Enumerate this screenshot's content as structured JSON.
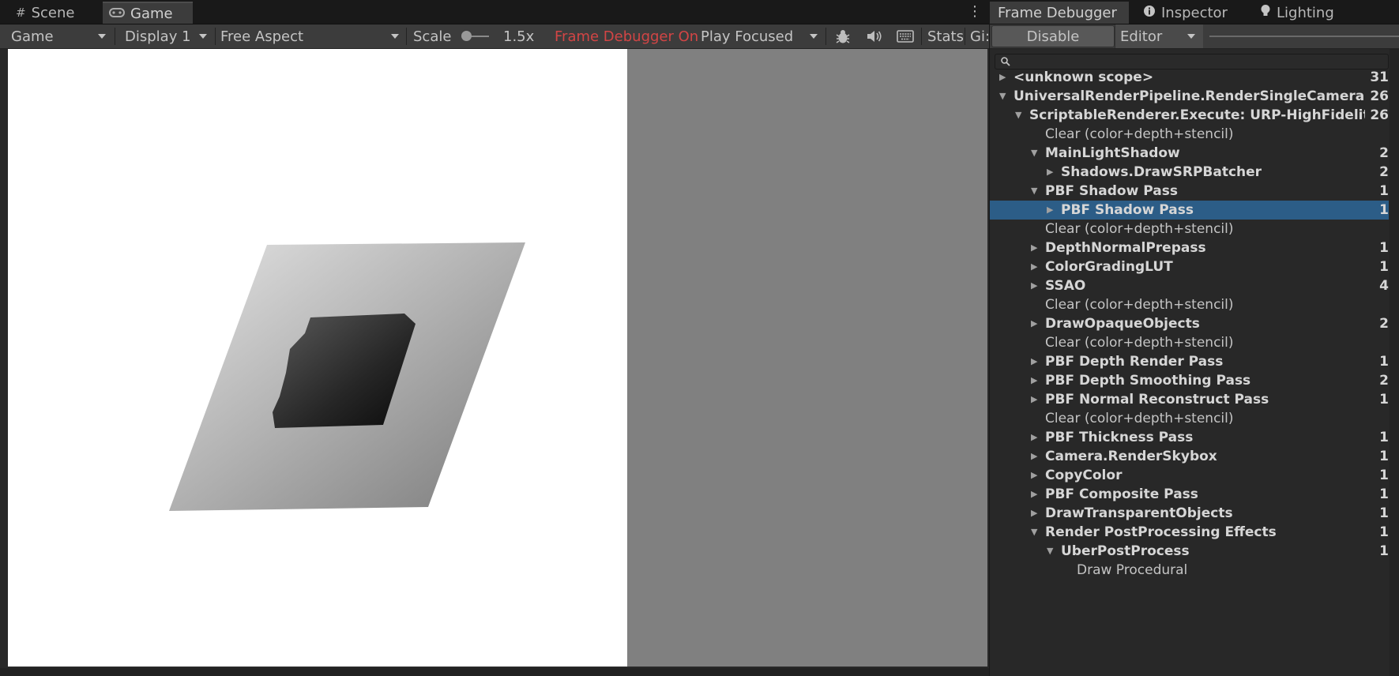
{
  "left": {
    "tabs": [
      {
        "label": "Scene",
        "icon": "grid-hash-icon"
      },
      {
        "label": "Game",
        "icon": "gamepad-icon"
      }
    ],
    "toolbar": {
      "view_select": "Game",
      "display_select": "Display 1",
      "aspect_select": "Free Aspect",
      "scale_label": "Scale",
      "scale_value": "1.5x",
      "frame_debugger_status": "Frame Debugger On",
      "play_mode_select": "Play Focused",
      "stats_label": "Stats",
      "gizmos_label": "Gi:"
    }
  },
  "right": {
    "tabs": [
      {
        "label": "Frame Debugger"
      },
      {
        "label": "Inspector",
        "icon": "info-icon"
      },
      {
        "label": "Lighting",
        "icon": "bulb-icon"
      }
    ],
    "toolbar": {
      "disable_button": "Disable",
      "target_select": "Editor"
    },
    "search": {
      "placeholder": ""
    },
    "tree": [
      {
        "label": "<unknown scope>",
        "count": "31",
        "depth": 0,
        "expander": "collapsed",
        "bold": true
      },
      {
        "label": "UniversalRenderPipeline.RenderSingleCameraInternal",
        "count": "26",
        "depth": 0,
        "expander": "expanded",
        "bold": true
      },
      {
        "label": "ScriptableRenderer.Execute: URP-HighFidelity-Renderer",
        "count": "26",
        "depth": 1,
        "expander": "expanded",
        "bold": true
      },
      {
        "label": "Clear (color+depth+stencil)",
        "count": "",
        "depth": 2,
        "expander": "none",
        "bold": false
      },
      {
        "label": "MainLightShadow",
        "count": "2",
        "depth": 2,
        "expander": "expanded",
        "bold": true
      },
      {
        "label": "Shadows.DrawSRPBatcher",
        "count": "2",
        "depth": 3,
        "expander": "collapsed",
        "bold": true
      },
      {
        "label": "PBF Shadow Pass",
        "count": "1",
        "depth": 2,
        "expander": "expanded",
        "bold": true
      },
      {
        "label": "PBF Shadow Pass",
        "count": "1",
        "depth": 3,
        "expander": "collapsed",
        "bold": true,
        "selected": true
      },
      {
        "label": "Clear (color+depth+stencil)",
        "count": "",
        "depth": 2,
        "expander": "none",
        "bold": false
      },
      {
        "label": "DepthNormalPrepass",
        "count": "1",
        "depth": 2,
        "expander": "collapsed",
        "bold": true
      },
      {
        "label": "ColorGradingLUT",
        "count": "1",
        "depth": 2,
        "expander": "collapsed",
        "bold": true
      },
      {
        "label": "SSAO",
        "count": "4",
        "depth": 2,
        "expander": "collapsed",
        "bold": true
      },
      {
        "label": "Clear (color+depth+stencil)",
        "count": "",
        "depth": 2,
        "expander": "none",
        "bold": false
      },
      {
        "label": "DrawOpaqueObjects",
        "count": "2",
        "depth": 2,
        "expander": "collapsed",
        "bold": true
      },
      {
        "label": "Clear (color+depth+stencil)",
        "count": "",
        "depth": 2,
        "expander": "none",
        "bold": false
      },
      {
        "label": "PBF Depth Render Pass",
        "count": "1",
        "depth": 2,
        "expander": "collapsed",
        "bold": true
      },
      {
        "label": "PBF Depth Smoothing Pass",
        "count": "2",
        "depth": 2,
        "expander": "collapsed",
        "bold": true
      },
      {
        "label": "PBF Normal Reconstruct Pass",
        "count": "1",
        "depth": 2,
        "expander": "collapsed",
        "bold": true
      },
      {
        "label": "Clear (color+depth+stencil)",
        "count": "",
        "depth": 2,
        "expander": "none",
        "bold": false
      },
      {
        "label": "PBF Thickness Pass",
        "count": "1",
        "depth": 2,
        "expander": "collapsed",
        "bold": true
      },
      {
        "label": "Camera.RenderSkybox",
        "count": "1",
        "depth": 2,
        "expander": "collapsed",
        "bold": true
      },
      {
        "label": "CopyColor",
        "count": "1",
        "depth": 2,
        "expander": "collapsed",
        "bold": true
      },
      {
        "label": "PBF Composite Pass",
        "count": "1",
        "depth": 2,
        "expander": "collapsed",
        "bold": true
      },
      {
        "label": "DrawTransparentObjects",
        "count": "1",
        "depth": 2,
        "expander": "collapsed",
        "bold": true
      },
      {
        "label": "Render PostProcessing Effects",
        "count": "1",
        "depth": 2,
        "expander": "expanded",
        "bold": true
      },
      {
        "label": "UberPostProcess",
        "count": "1",
        "depth": 3,
        "expander": "expanded",
        "bold": true
      },
      {
        "label": "Draw Procedural",
        "count": "",
        "depth": 4,
        "expander": "none",
        "bold": false
      }
    ]
  },
  "colors": {
    "frame_debugger_on": "#d24545",
    "selection": "#2c5d87",
    "game_background": "#ffffff",
    "letterbox_gray": "#808080"
  }
}
